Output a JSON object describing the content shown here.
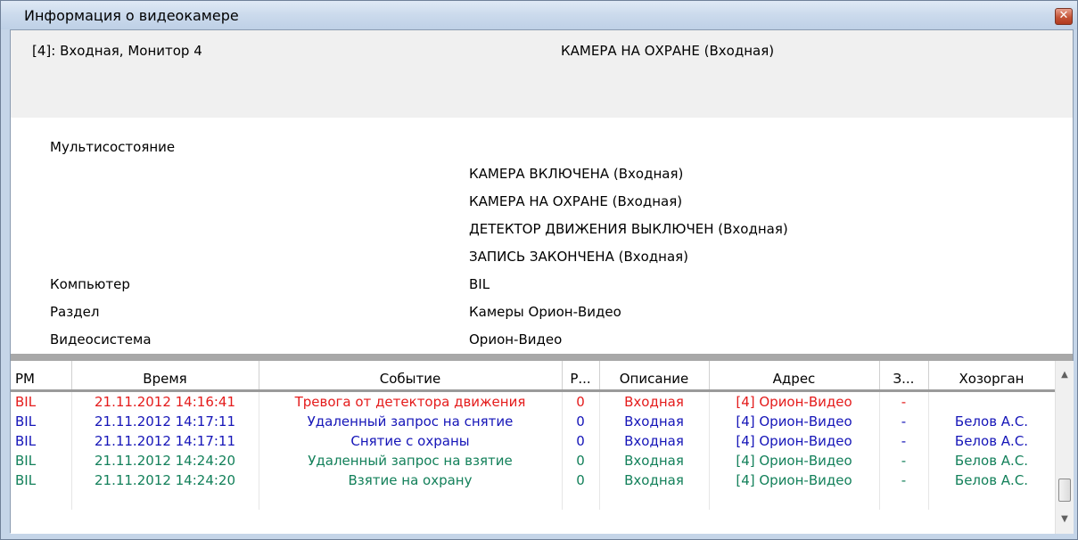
{
  "window": {
    "title": "Информация о видеокамере",
    "close_icon": "close-icon"
  },
  "header": {
    "left": "[4]: Входная, Монитор 4",
    "right": "КАМЕРА НА ОХРАНЕ (Входная)"
  },
  "info": {
    "multistate_label": "Мультисостояние",
    "states": [
      "КАМЕРА ВКЛЮЧЕНА (Входная)",
      "КАМЕРА НА ОХРАНЕ (Входная)",
      "ДЕТЕКТОР ДВИЖЕНИЯ ВЫКЛЮЧЕН (Входная)",
      "ЗАПИСЬ ЗАКОНЧЕНА (Входная)"
    ],
    "computer_label": "Компьютер",
    "computer_value": "BIL",
    "section_label": "Раздел",
    "section_value": "Камеры Орион-Видео",
    "videosystem_label": "Видеосистема",
    "videosystem_value": "Орион-Видео"
  },
  "table": {
    "columns": [
      "РМ",
      "Время",
      "Событие",
      "Р...",
      "Описание",
      "Адрес",
      "З...",
      "Хозорган"
    ],
    "rows": [
      {
        "color": "#e41b1b",
        "cells": [
          "BIL",
          "21.11.2012 14:16:41",
          "Тревога от детектора движения",
          "0",
          "Входная",
          "[4] Орион-Видео",
          "-",
          ""
        ]
      },
      {
        "color": "#1515b8",
        "cells": [
          "BIL",
          "21.11.2012 14:17:11",
          "Удаленный запрос на снятие",
          "0",
          "Входная",
          "[4] Орион-Видео",
          "-",
          "Белов А.С."
        ]
      },
      {
        "color": "#1515b8",
        "cells": [
          "BIL",
          "21.11.2012 14:17:11",
          "Снятие с охраны",
          "0",
          "Входная",
          "[4] Орион-Видео",
          "-",
          "Белов А.С."
        ]
      },
      {
        "color": "#13805a",
        "cells": [
          "BIL",
          "21.11.2012 14:24:20",
          "Удаленный запрос на взятие",
          "0",
          "Входная",
          "[4] Орион-Видео",
          "-",
          "Белов А.С."
        ]
      },
      {
        "color": "#13805a",
        "cells": [
          "BIL",
          "21.11.2012 14:24:20",
          "Взятие на охрану",
          "0",
          "Входная",
          "[4] Орион-Видео",
          "-",
          "Белов А.С."
        ]
      }
    ]
  },
  "scrollbar": {
    "up_icon": "scroll-up-arrow-icon",
    "down_icon": "scroll-down-arrow-icon"
  }
}
